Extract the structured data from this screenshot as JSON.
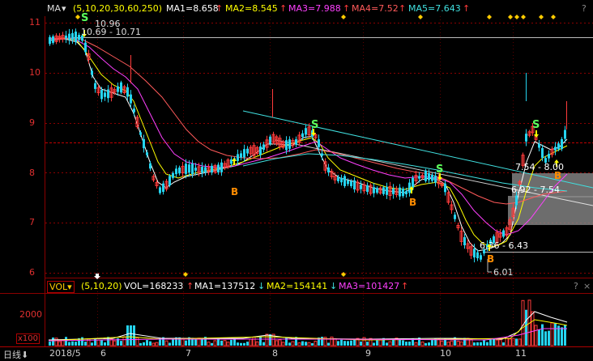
{
  "header": {
    "ma_label": "MA",
    "ma_params": "(5,10,20,30,60,250)",
    "ma1": "MA1=8.658",
    "ma2": "MA2=8.545",
    "ma3": "MA3=7.988",
    "ma4": "MA4=7.52",
    "ma5": "MA5=7.643",
    "help": "?"
  },
  "price_axis": {
    "ticks": [
      "11",
      "10",
      "9",
      "8",
      "7",
      "6"
    ]
  },
  "annotations": {
    "high_label": "10.96",
    "range1": "10.69 - 10.71",
    "range2": "7.54 - 8.00",
    "range3": "6.92 - 7.54",
    "range4": "6.36 - 6.43",
    "low_label": "6.01",
    "sell": "S",
    "buy": "B"
  },
  "volume_header": {
    "label": "VOL",
    "params": "(5,10,20)",
    "vol": "VOL=168233",
    "ma1": "MA1=137512",
    "ma2": "MA2=154141",
    "ma3": "MA3=101427",
    "help": "?",
    "close": "×"
  },
  "volume_axis": {
    "tick": "2000",
    "unit": "x100"
  },
  "x_axis": {
    "period": "日线",
    "labels": [
      "2018/5",
      "6",
      "7",
      "8",
      "9",
      "10",
      "11"
    ]
  },
  "colors": {
    "up": "#ff3b3b",
    "down": "#25d4ef",
    "grid": "#8b0000",
    "ma1": "#ffffff",
    "ma2": "#ffff00",
    "ma3": "#ff40ff",
    "ma4": "#ff5a5a",
    "ma5": "#40e0e0"
  }
}
